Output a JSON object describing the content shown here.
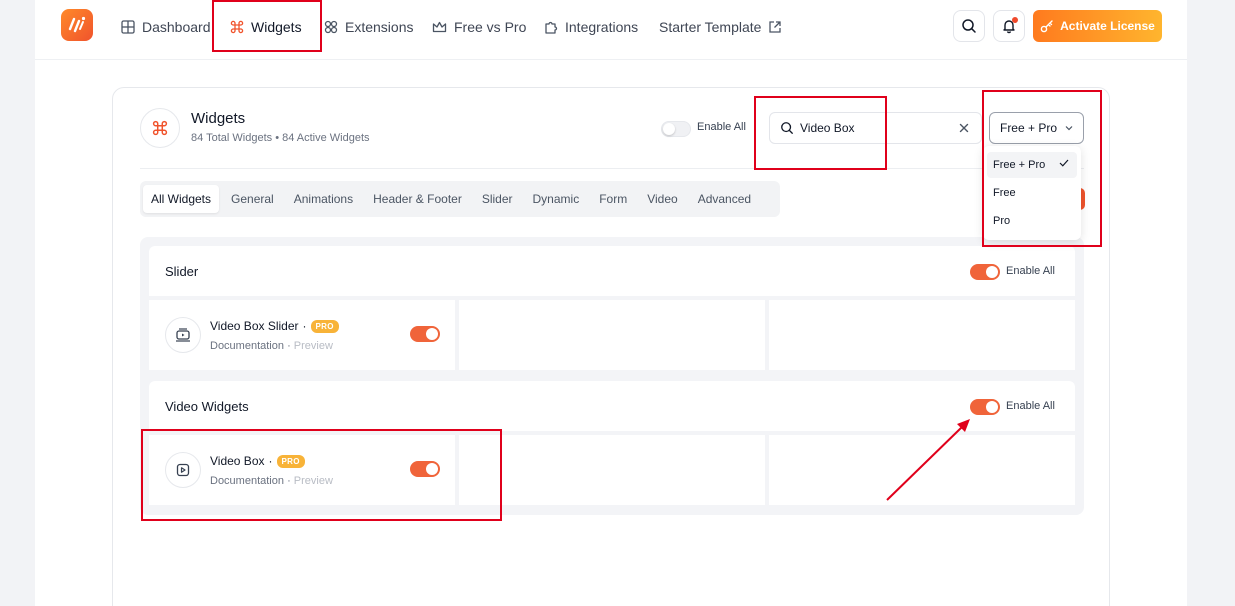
{
  "nav": {
    "items": [
      {
        "label": "Dashboard",
        "icon": "grid-icon"
      },
      {
        "label": "Widgets",
        "icon": "command-icon"
      },
      {
        "label": "Extensions",
        "icon": "extensions-icon"
      },
      {
        "label": "Free vs Pro",
        "icon": "crown-icon"
      },
      {
        "label": "Integrations",
        "icon": "puzzle-icon"
      },
      {
        "label": "Starter Template",
        "icon": "external-link-icon"
      }
    ],
    "active": "Widgets",
    "license_label": "Activate License"
  },
  "widgets_header": {
    "title": "Widgets",
    "total": "84 Total Widgets",
    "separator": "•",
    "active": "84 Active Widgets",
    "enable_all_label": "Enable All",
    "enable_all_on": false
  },
  "search": {
    "value": "Video Box"
  },
  "filter": {
    "selected": "Free + Pro",
    "options": [
      "Free + Pro",
      "Free",
      "Pro"
    ]
  },
  "tabs": [
    "All Widgets",
    "General",
    "Animations",
    "Header & Footer",
    "Slider",
    "Dynamic",
    "Form",
    "Video",
    "Advanced"
  ],
  "active_tab": "All Widgets",
  "groups": [
    {
      "title": "Slider",
      "enable_all_label": "Enable All",
      "enable_all_on": true,
      "widgets": [
        {
          "name": "Video Box Slider",
          "dot": "·",
          "badge": "PRO",
          "doc": "Documentation",
          "link_sep": "·",
          "preview": "Preview",
          "enabled": true,
          "icon": "video-slider-icon"
        }
      ]
    },
    {
      "title": "Video Widgets",
      "enable_all_label": "Enable All",
      "enable_all_on": true,
      "widgets": [
        {
          "name": "Video Box",
          "dot": "·",
          "badge": "PRO",
          "doc": "Documentation",
          "link_sep": "·",
          "preview": "Preview",
          "enabled": true,
          "icon": "video-play-icon"
        }
      ]
    }
  ],
  "colors": {
    "accent": "#f0643a",
    "license_start": "#ff7a1e",
    "license_end": "#ffb52e",
    "pro_badge": "#f8b338",
    "annotation": "#e0001b"
  }
}
